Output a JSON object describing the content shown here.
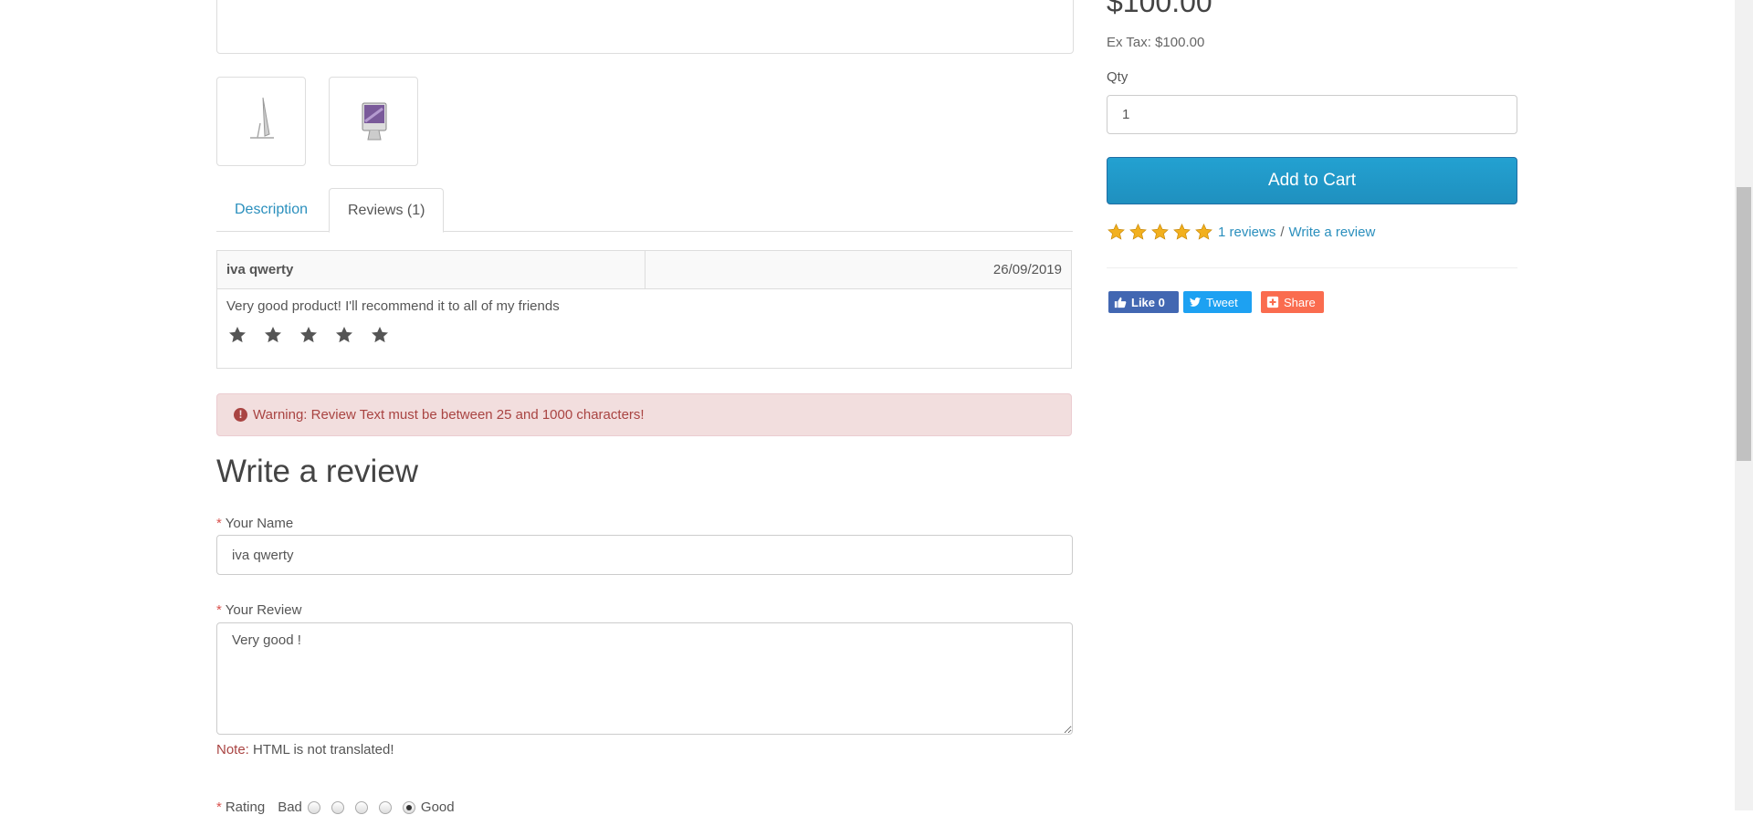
{
  "product": {
    "price": "$100.00",
    "ex_tax": "Ex Tax: $100.00",
    "qty_label": "Qty",
    "qty_value": "1",
    "add_to_cart": "Add to Cart",
    "average_rating": 5,
    "reviews_link": "1 reviews",
    "separator": "/",
    "write_review_link": "Write a review"
  },
  "social": {
    "like_label": "Like 0",
    "tweet_label": "Tweet",
    "share_label": "Share"
  },
  "tabs": [
    {
      "label": "Description",
      "active": false
    },
    {
      "label": "Reviews (1)",
      "active": true
    }
  ],
  "reviews": [
    {
      "author": "iva qwerty",
      "date": "26/09/2019",
      "text": "Very good product! I'll recommend it to all of my friends",
      "rating": 5
    }
  ],
  "alert": {
    "text": "Warning: Review Text must be between 25 and 1000 characters!"
  },
  "form": {
    "title": "Write a review",
    "required_mark": "*",
    "name_label": "Your Name",
    "name_value": "iva qwerty",
    "review_label": "Your Review",
    "review_value": "Very good !",
    "note_key": "Note:",
    "note_text": "HTML is not translated!",
    "rating_label": "Rating",
    "rating_bad": "Bad",
    "rating_good": "Good",
    "rating_selected": 5
  },
  "colors": {
    "link": "#2a8fbd",
    "button": "#229ac8",
    "alert_bg": "#f2dede",
    "alert_text": "#a94442",
    "star_gold": "#f2b01e"
  }
}
